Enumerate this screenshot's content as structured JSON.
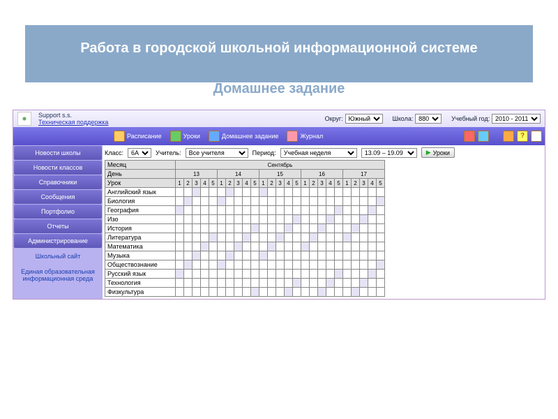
{
  "slide": {
    "title": "Работа в городской школьной информационной системе",
    "subtitle": "Домашнее задание"
  },
  "top": {
    "support": "Support s.s.",
    "tech": "Техническая поддержка",
    "okrug_lbl": "Округ:",
    "okrug_val": "Южный",
    "school_lbl": "Школа:",
    "school_val": "880",
    "year_lbl": "Учебный год:",
    "year_val": "2010 - 2011"
  },
  "menu": {
    "schedule": "Расписание",
    "lessons": "Уроки",
    "homework": "Домашнее задание",
    "journal": "Журнал"
  },
  "side": {
    "items": [
      "Новости школы",
      "Новости классов",
      "Справочники",
      "Сообщения",
      "Портфолио",
      "Отчеты",
      "Администрирование"
    ],
    "link1": "Школьный сайт",
    "link2": "Единая образовательная информационная среда"
  },
  "filters": {
    "class_lbl": "Класс:",
    "class_val": "6А",
    "teacher_lbl": "Учитель:",
    "teacher_val": "Все учителя",
    "period_lbl": "Период:",
    "period_val": "Учебная неделя",
    "range": "13.09 – 19.09",
    "go": "Уроки"
  },
  "grid": {
    "month_lbl": "Месяц",
    "month_val": "Сентябрь",
    "day_lbl": "День",
    "days": [
      "13",
      "14",
      "15",
      "16",
      "17"
    ],
    "lesson_lbl": "Урок",
    "lessons": [
      "1",
      "2",
      "3",
      "4",
      "5"
    ],
    "subjects": [
      "Английский язык",
      "Биология",
      "География",
      "Изо",
      "История",
      "Литература",
      "Математика",
      "Музыка",
      "Обществознание",
      "Русский язык",
      "Технология",
      "Физкультура"
    ]
  }
}
